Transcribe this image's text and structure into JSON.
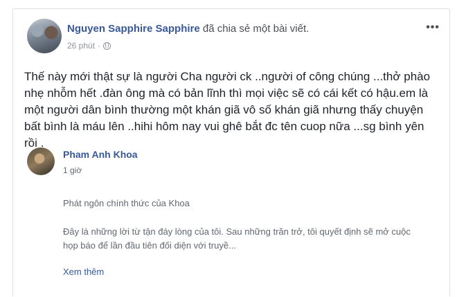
{
  "post": {
    "author": "Nguyen Sapphire Sapphire",
    "action": " đã chia sẻ một bài viết.",
    "time": "26 phút",
    "separator": "·",
    "privacy_icon": "globe-icon",
    "more_icon": "•••",
    "text": "Thế này mới thật sự là người Cha người ck ..người of công chúng ...thở phào nhẹ nhỗm hết .đàn ông mà có bản lĩnh thì mọi việc sẽ có cái kết có hậu.em là một người dân bình thường một khán giã vô số khán giã nhưng thấy chuyện bất bình là máu lên ..hihi hôm nay vui ghê bắt đc tên cuop nữa ...sg bình yên rồi ."
  },
  "shared_post": {
    "author": "Pham Anh Khoa",
    "time": "1 giờ",
    "paragraph1": "Phát ngôn chính thức của Khoa",
    "paragraph2": "Đây là những lời từ tận đáy lòng của tôi. Sau những trăn trở, tôi quyết định sẽ mở cuộc họp báo để lần đầu tiên đối diện với truyề...",
    "see_more": "Xem thêm"
  },
  "colors": {
    "link": "#385898",
    "text": "#1d2129",
    "meta": "#90949c",
    "border": "#dddfe2"
  }
}
